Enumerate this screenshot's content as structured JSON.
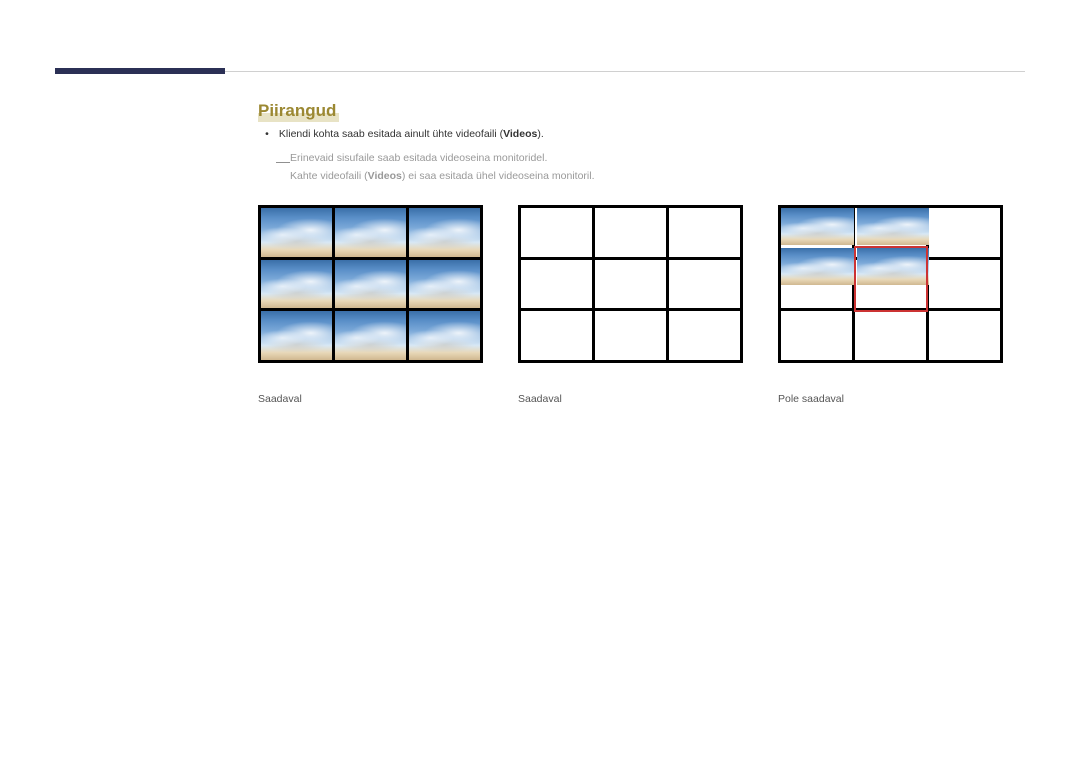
{
  "section": {
    "title": "Piirangud",
    "bullet1_prefix": "Kliendi kohta saab esitada ainult ühte videofaili (",
    "bullet1_videos": "Videos",
    "bullet1_suffix": ").",
    "sub_line1": "Erinevaid sisufaile saab esitada videoseina monitoridel.",
    "sub_line2_prefix": "Kahte videofaili (",
    "sub_line2_videos": "Videos",
    "sub_line2_suffix": ") ei saa esitada ühel videoseina monitoril."
  },
  "captions": {
    "available1": "Saadaval",
    "available2": "Saadaval",
    "not_available": "Pole saadaval"
  }
}
